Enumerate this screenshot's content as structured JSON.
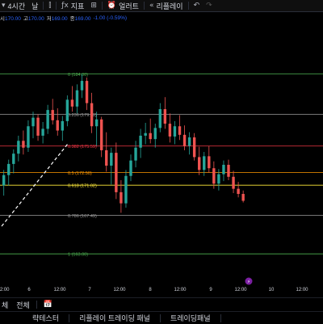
{
  "toolbar": {
    "interval": "4시간",
    "interval_unit": "날",
    "indicators_label": "지표",
    "alerts_label": "얼러트",
    "replay_label": "리플레이"
  },
  "ohlc": {
    "open_key": "시",
    "open_val": "170.00",
    "high_key": "고",
    "high_val": "170.00",
    "low_key": "저",
    "low_val": "169.00",
    "close_key": "종",
    "close_val": "169.00",
    "change": "-1.00 (-0.59%)"
  },
  "chart_data": {
    "type": "candlestick",
    "y_range": [
      160.0,
      190.0
    ],
    "x_ticks": [
      "12:00",
      "6",
      "12:00",
      "7",
      "12:00",
      "8",
      "12:00",
      "9",
      "12:00",
      "10",
      "12:00"
    ],
    "fib_levels": [
      {
        "ratio": "0",
        "price": 184.0,
        "label": "0 (184.00)",
        "color": "#4caf50"
      },
      {
        "ratio": "0.236",
        "price": 179.28,
        "label": "0.236 (179.28)",
        "color": "#9e9e9e"
      },
      {
        "ratio": "0.382",
        "price": 175.59,
        "label": "0.382 (175.59)",
        "color": "#f23645"
      },
      {
        "ratio": "0.5",
        "price": 172.5,
        "label": "0.5 (172.50)",
        "color": "#ff9800"
      },
      {
        "ratio": "0.618",
        "price": 171.02,
        "label": "0.618 (171.02)",
        "color": "#ffeb3b"
      },
      {
        "ratio": "0.786",
        "price": 167.49,
        "label": "0.786 (167.49)",
        "color": "#9e9e9e"
      },
      {
        "ratio": "1",
        "price": 163.0,
        "label": "1 (163.00)",
        "color": "#4caf50"
      }
    ],
    "candles": [
      [
        171.0,
        172.8,
        169.8,
        172.2
      ],
      [
        172.2,
        174.0,
        171.0,
        173.5
      ],
      [
        173.5,
        175.2,
        172.4,
        174.7
      ],
      [
        174.7,
        176.8,
        173.8,
        176.2
      ],
      [
        176.2,
        177.4,
        174.6,
        175.4
      ],
      [
        175.4,
        178.6,
        174.9,
        177.9
      ],
      [
        177.9,
        179.6,
        176.5,
        178.9
      ],
      [
        178.9,
        179.3,
        176.2,
        176.8
      ],
      [
        176.8,
        178.4,
        175.9,
        177.6
      ],
      [
        177.6,
        180.4,
        177.0,
        179.8
      ],
      [
        179.8,
        181.1,
        178.1,
        178.6
      ],
      [
        178.6,
        180.0,
        176.8,
        177.4
      ],
      [
        177.4,
        179.1,
        176.2,
        178.5
      ],
      [
        178.5,
        181.5,
        177.9,
        181.0
      ],
      [
        181.0,
        182.6,
        179.6,
        180.2
      ],
      [
        180.2,
        182.8,
        179.4,
        182.1
      ],
      [
        182.1,
        184.0,
        181.2,
        183.2
      ],
      [
        183.2,
        183.6,
        179.8,
        180.6
      ],
      [
        180.6,
        181.8,
        177.1,
        177.9
      ],
      [
        177.9,
        179.6,
        175.6,
        178.7
      ],
      [
        178.7,
        179.0,
        174.3,
        175.1
      ],
      [
        175.1,
        177.2,
        172.6,
        173.3
      ],
      [
        173.3,
        175.4,
        171.1,
        174.8
      ],
      [
        174.8,
        176.0,
        169.4,
        170.2
      ],
      [
        170.2,
        171.6,
        167.8,
        168.9
      ],
      [
        168.9,
        172.8,
        168.4,
        172.1
      ],
      [
        172.1,
        174.6,
        171.5,
        173.9
      ],
      [
        173.9,
        176.2,
        173.1,
        175.4
      ],
      [
        175.4,
        177.6,
        174.2,
        176.8
      ],
      [
        176.8,
        178.3,
        175.8,
        177.1
      ],
      [
        177.1,
        178.8,
        175.9,
        176.4
      ],
      [
        176.4,
        178.2,
        175.4,
        177.7
      ],
      [
        177.7,
        180.6,
        177.2,
        179.9
      ],
      [
        179.9,
        181.3,
        177.6,
        178.2
      ],
      [
        178.2,
        179.4,
        176.0,
        176.7
      ],
      [
        176.7,
        178.5,
        175.8,
        177.9
      ],
      [
        177.9,
        179.2,
        176.3,
        176.9
      ],
      [
        176.9,
        178.0,
        175.1,
        175.6
      ],
      [
        175.6,
        177.2,
        174.6,
        176.6
      ],
      [
        176.6,
        177.1,
        173.9,
        174.3
      ],
      [
        174.3,
        175.5,
        172.2,
        172.8
      ],
      [
        172.8,
        174.9,
        172.1,
        174.4
      ],
      [
        174.4,
        175.6,
        172.5,
        173.0
      ],
      [
        173.0,
        173.8,
        170.6,
        171.2
      ],
      [
        171.2,
        172.9,
        170.4,
        172.3
      ],
      [
        172.3,
        173.9,
        171.5,
        173.4
      ],
      [
        173.4,
        174.0,
        171.6,
        172.0
      ],
      [
        172.0,
        172.7,
        170.1,
        170.6
      ],
      [
        170.6,
        171.4,
        169.6,
        170.0
      ],
      [
        170.0,
        170.4,
        169.0,
        169.2
      ]
    ]
  },
  "badge": {
    "symbol": "⚡"
  },
  "bottom": {
    "period_label": "체",
    "all_label": "전체"
  },
  "panels": {
    "tab1": "략테스터",
    "tab2": "리플레이 트레이딩 패널",
    "tab3": "트레이딩패널"
  },
  "colors": {
    "up": "#26a69a",
    "down": "#ef5350",
    "accent": "#2962ff"
  }
}
